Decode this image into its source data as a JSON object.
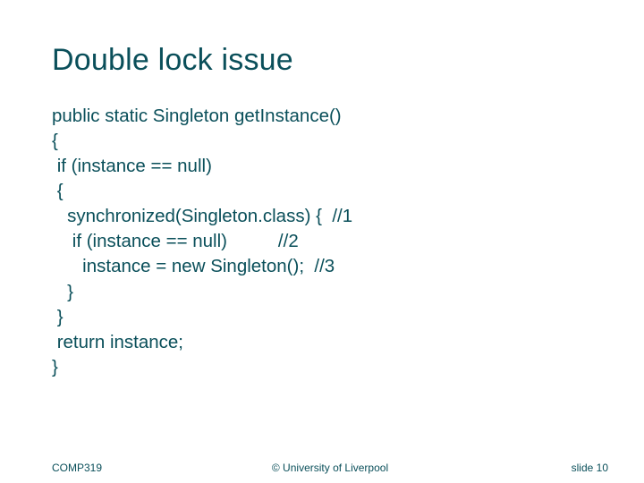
{
  "title": "Double lock issue",
  "code": "public static Singleton getInstance()\n{\n if (instance == null)\n {\n   synchronized(Singleton.class) {  //1\n    if (instance == null)          //2\n      instance = new Singleton();  //3\n   }\n }\n return instance;\n}",
  "footer": {
    "left": "COMP319",
    "center": "© University of Liverpool",
    "right": "slide  10"
  }
}
